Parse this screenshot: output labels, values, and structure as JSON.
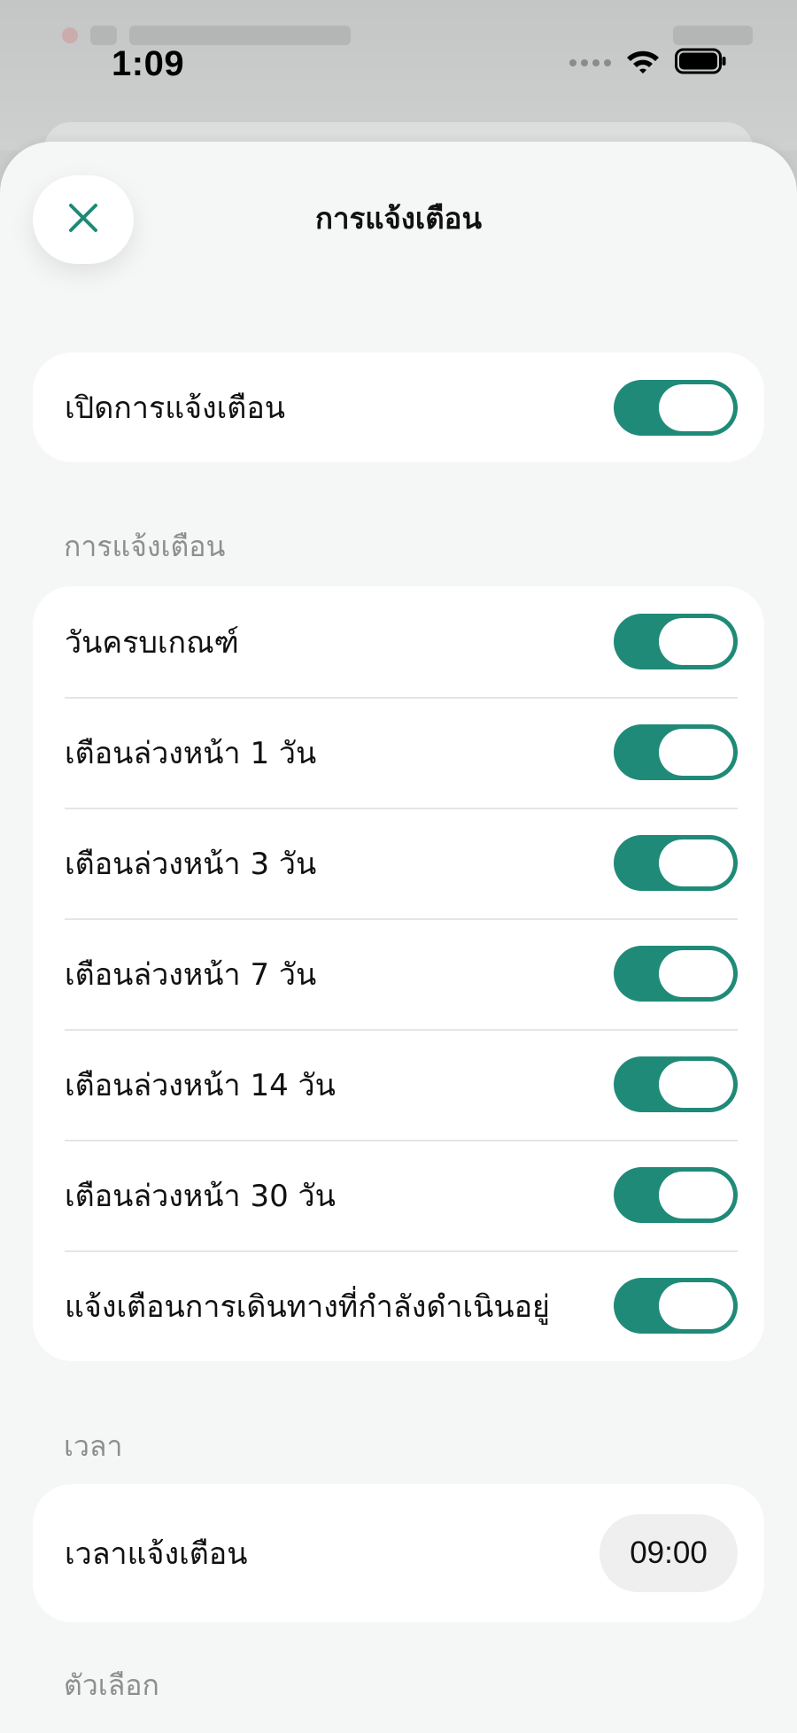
{
  "status_bar": {
    "time": "1:09"
  },
  "header": {
    "title": "การแจ้งเตือน",
    "close_icon": "close-icon"
  },
  "master": {
    "label": "เปิดการแจ้งเตือน",
    "enabled": true
  },
  "notifications_section": {
    "header": "การแจ้งเตือน",
    "items": [
      {
        "label": "วันครบเกณฑ์",
        "enabled": true
      },
      {
        "label": "เตือนล่วงหน้า 1 วัน",
        "enabled": true
      },
      {
        "label": "เตือนล่วงหน้า 3 วัน",
        "enabled": true
      },
      {
        "label": "เตือนล่วงหน้า 7 วัน",
        "enabled": true
      },
      {
        "label": "เตือนล่วงหน้า 14 วัน",
        "enabled": true
      },
      {
        "label": "เตือนล่วงหน้า 30 วัน",
        "enabled": true
      },
      {
        "label": "แจ้งเตือนการเดินทางที่กำลังดำเนินอยู่",
        "enabled": true
      }
    ]
  },
  "time_section": {
    "header": "เวลา",
    "label": "เวลาแจ้งเตือน",
    "value": "09:00"
  },
  "options_section": {
    "header": "ตัวเลือก"
  },
  "colors": {
    "accent": "#1f8a78",
    "sheet_background": "#f5f6f6",
    "card_background": "#ffffff"
  }
}
